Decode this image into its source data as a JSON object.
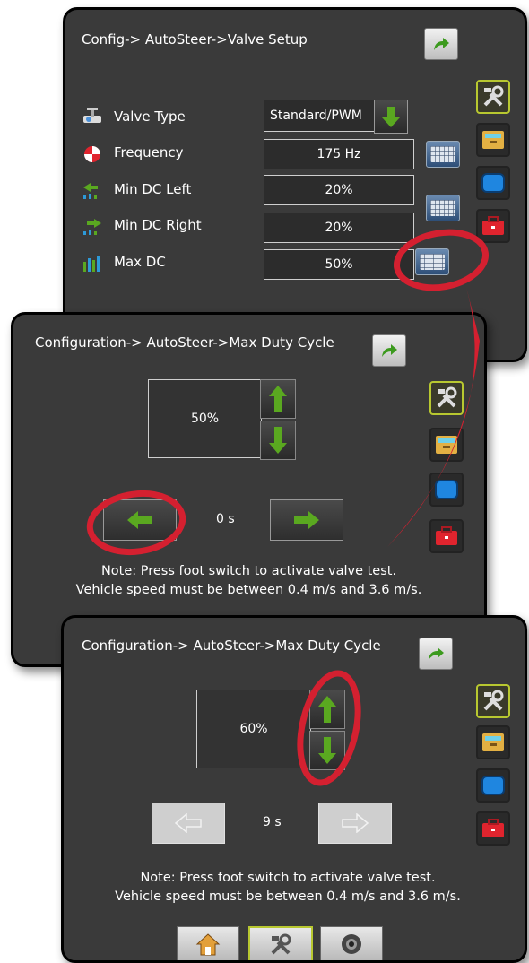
{
  "panel1": {
    "title": "Config-> AutoSteer->Valve Setup",
    "rows": [
      {
        "label": "Valve Type",
        "value": "Standard/PWM",
        "icon": "valve-icon"
      },
      {
        "label": "Frequency",
        "value": "175 Hz",
        "icon": "frequency-icon"
      },
      {
        "label": "Min DC Left",
        "value": "20%",
        "icon": "min-dc-left-icon"
      },
      {
        "label": "Min DC Right",
        "value": "20%",
        "icon": "min-dc-right-icon"
      },
      {
        "label": "Max DC",
        "value": "50%",
        "icon": "max-dc-icon"
      }
    ]
  },
  "panel2": {
    "title": "Configuration-> AutoSteer->Max Duty Cycle",
    "value": "50%",
    "timer": "0 s",
    "note_line1": "Note: Press foot switch to activate valve test.",
    "note_line2": "Vehicle speed must be between 0.4 m/s and 3.6 m/s."
  },
  "panel3": {
    "title": "Configuration-> AutoSteer->Max Duty Cycle",
    "value": "60%",
    "timer": "9 s",
    "note_line1": "Note: Press foot switch to activate valve test.",
    "note_line2": "Vehicle speed must be between 0.4 m/s and 3.6 m/s."
  },
  "side_tabs": [
    "tools-icon",
    "console-icon",
    "screen-icon",
    "toolbox-icon"
  ],
  "bottom_tabs": [
    "home-icon",
    "tools-icon",
    "camera-icon"
  ],
  "colors": {
    "accent_green": "#5aa820",
    "highlight_red": "#d42030",
    "active_tab": "#b8c830"
  }
}
